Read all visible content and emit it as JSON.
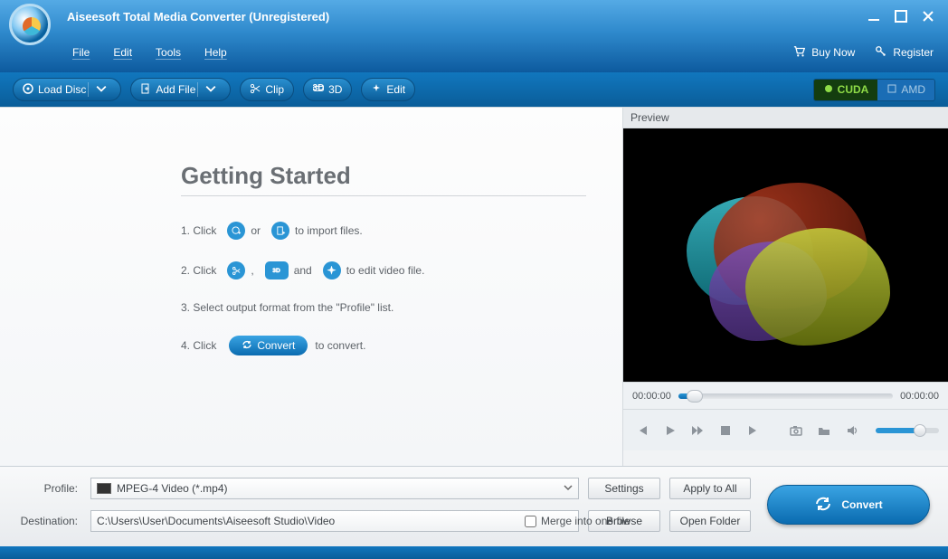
{
  "title": "Aiseesoft Total Media Converter (Unregistered)",
  "menu": {
    "file": "File",
    "edit": "Edit",
    "tools": "Tools",
    "help": "Help"
  },
  "top_right": {
    "buy": "Buy Now",
    "register": "Register"
  },
  "toolbar": {
    "load": "Load Disc",
    "add": "Add File",
    "clip": "Clip",
    "threed": "3D",
    "edit": "Edit"
  },
  "gpu": {
    "cuda": "CUDA",
    "amd": "AMD"
  },
  "gs": {
    "title": "Getting Started",
    "s1a": "1. Click",
    "s1b": "or",
    "s1c": "to import files.",
    "s2a": "2. Click",
    "s2b": ",",
    "s2c": "and",
    "s2d": "to edit video file.",
    "s3": "3. Select output format from the \"Profile\" list.",
    "s4a": "4. Click",
    "s4btn": "Convert",
    "s4b": "to convert."
  },
  "preview": {
    "label": "Preview",
    "t0": "00:00:00",
    "t1": "00:00:00"
  },
  "footer": {
    "profile_label": "Profile:",
    "profile_value": "MPEG-4 Video (*.mp4)",
    "settings": "Settings",
    "apply": "Apply to All",
    "dest_label": "Destination:",
    "dest_value": "C:\\Users\\User\\Documents\\Aiseesoft Studio\\Video",
    "browse": "Browse",
    "open": "Open Folder",
    "merge": "Merge into one file",
    "convert": "Convert"
  }
}
